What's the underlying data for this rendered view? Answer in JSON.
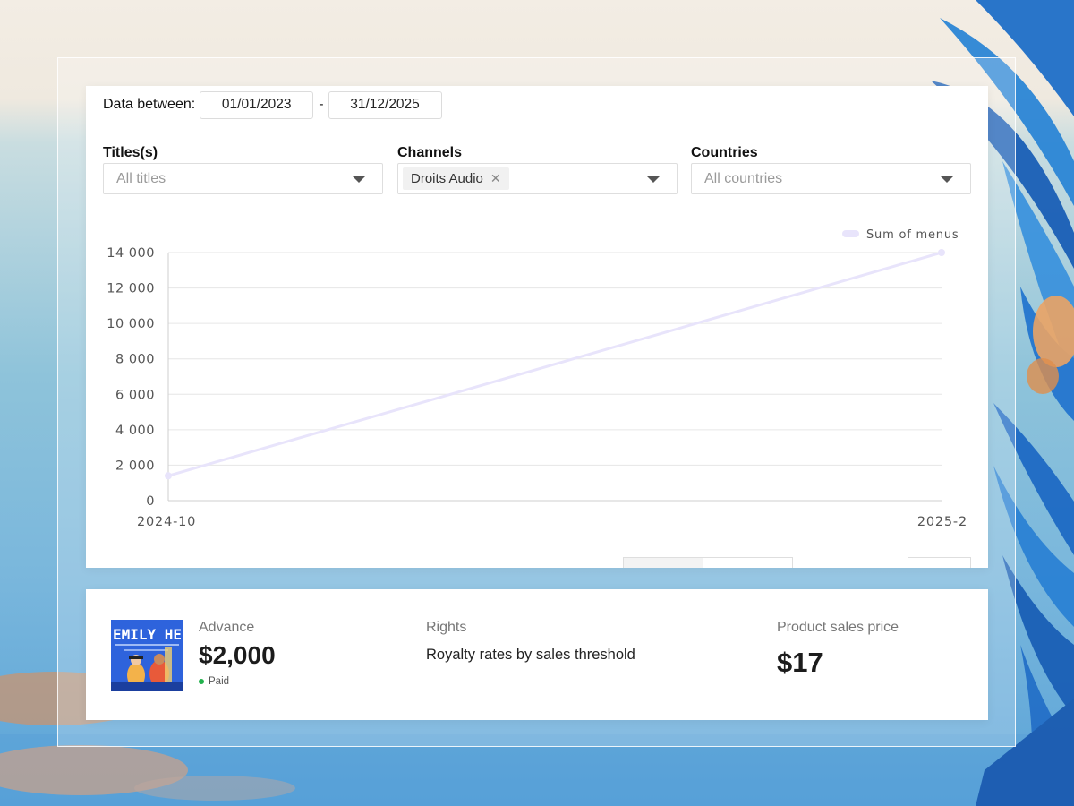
{
  "filters_bar": {
    "date_label": "Data between:",
    "date_from": "01/01/2023",
    "date_sep": "-",
    "date_to": "31/12/2025"
  },
  "filters": {
    "titles": {
      "label": "Titles(s)",
      "placeholder": "All titles"
    },
    "channels": {
      "label": "Channels",
      "tag": "Droits Audio",
      "tag_remove_icon": "close-icon"
    },
    "countries": {
      "label": "Countries",
      "placeholder": "All countries"
    }
  },
  "chart_data": {
    "type": "line",
    "x": [
      "2024-10",
      "2025-2"
    ],
    "series": [
      {
        "name": "Sum of menus",
        "values": [
          1400,
          14000
        ],
        "color": "#e8e4fb"
      }
    ],
    "ylim": [
      0,
      14000
    ],
    "yticks": [
      "0",
      "2 000",
      "4 000",
      "6 000",
      "8 000",
      "10 000",
      "12 000",
      "14 000"
    ],
    "grid": true,
    "legend": "top-right"
  },
  "info": {
    "cover_text": "EMILY HEN",
    "advance_label": "Advance",
    "advance_value": "$2,000",
    "advance_status": "Paid",
    "status_color": "#22b14c",
    "rights_label": "Rights",
    "rights_value": "Royalty rates by sales threshold",
    "price_label": "Product sales price",
    "price_value": "$17"
  }
}
